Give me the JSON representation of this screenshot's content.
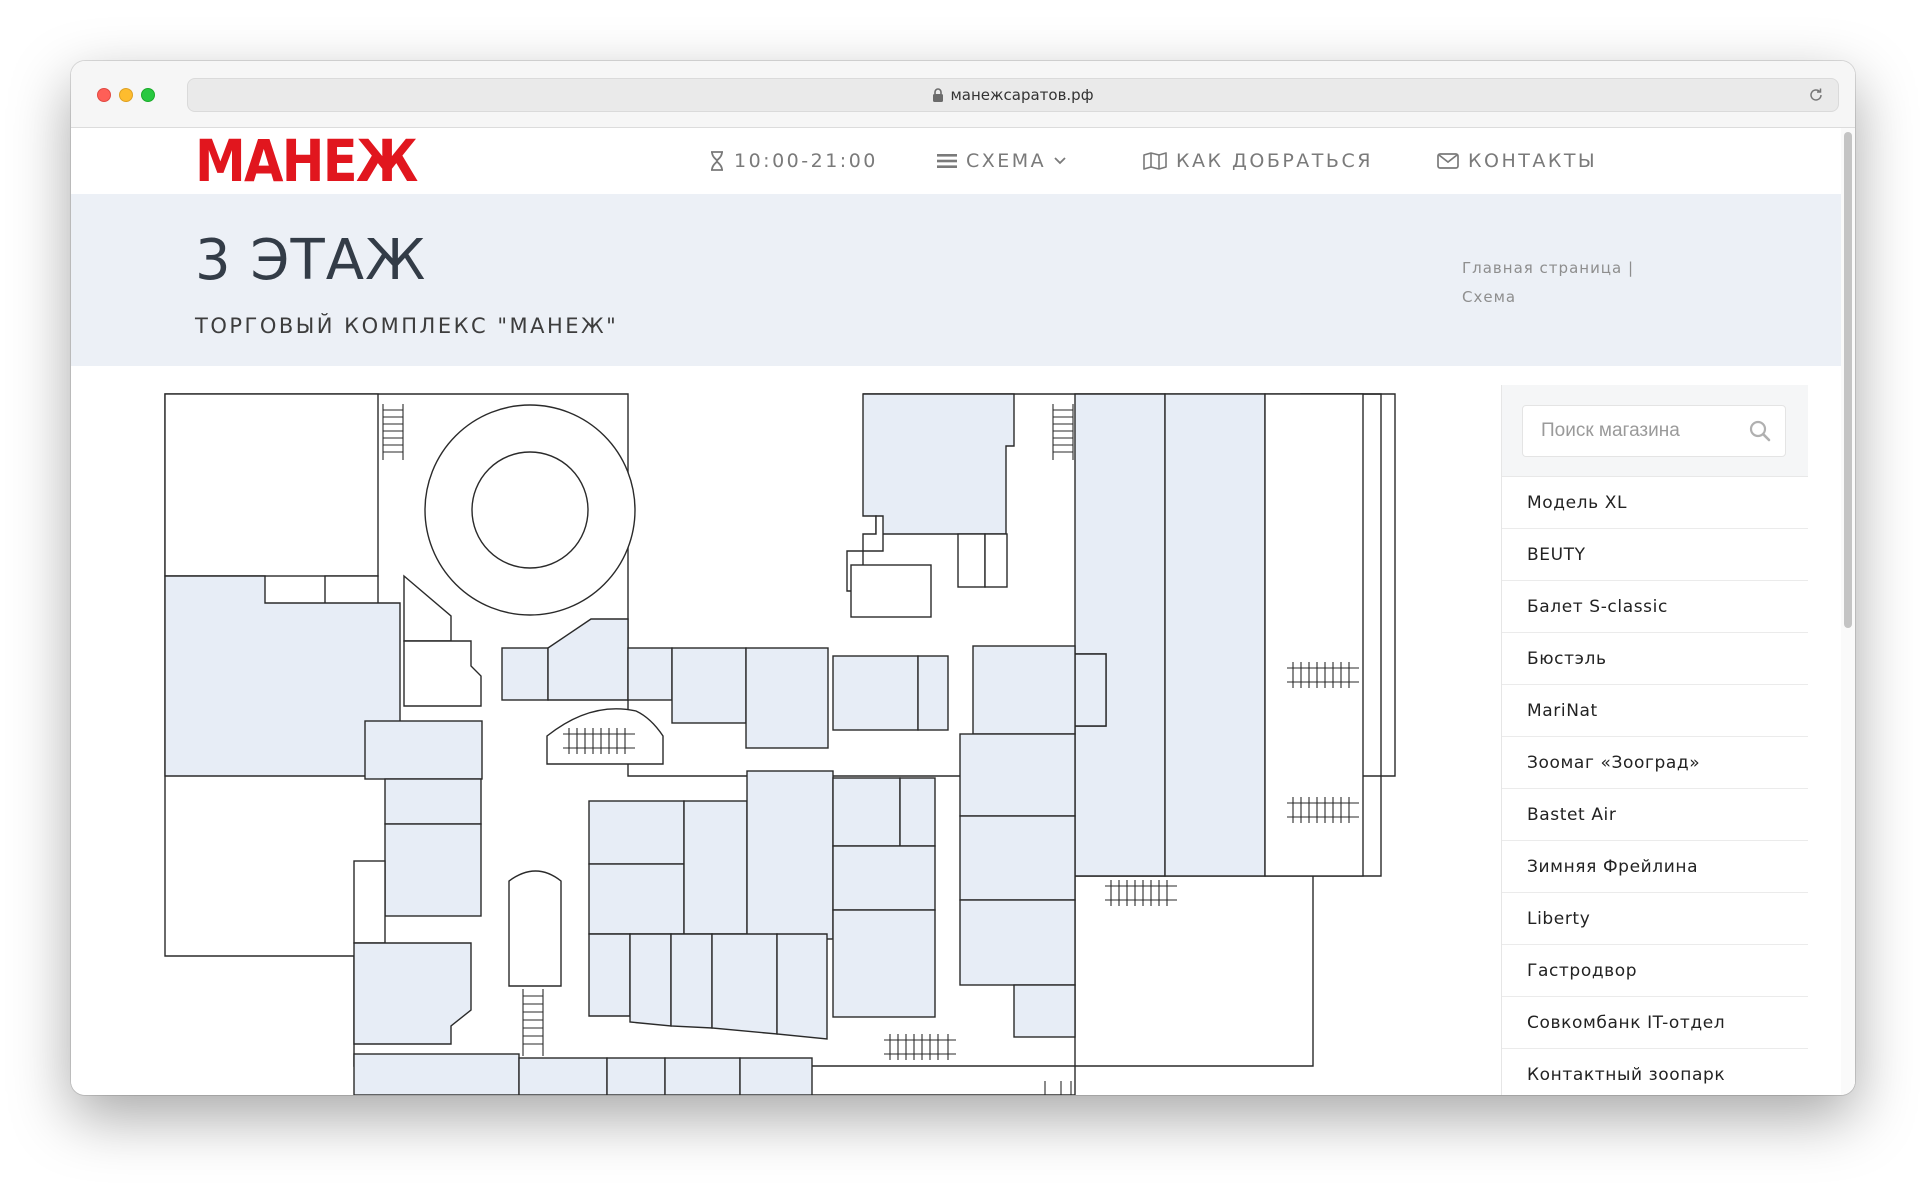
{
  "browser": {
    "url": "манежсаратов.рф"
  },
  "nav": {
    "logo": "МАНЕЖ",
    "hours": "10:00-21:00",
    "scheme": "СХЕМА",
    "route": "КАК ДОБРАТЬСЯ",
    "contacts": "КОНТАКТЫ"
  },
  "header": {
    "title": "3 ЭТАЖ",
    "subtitle": "ТОРГОВЫЙ КОМПЛЕКС \"МАНЕЖ\"",
    "breadcrumb": {
      "home": "Главная страница",
      "separator": "|",
      "current": "Схема"
    }
  },
  "sidebar": {
    "search_placeholder": "Поиск магазина",
    "stores": [
      "Модель XL",
      "BEUTY",
      "Балет S-classic",
      "Бюстэль",
      "MariNat",
      "Зоомаг «Зооград»",
      "Bastet Air",
      "Зимняя Фрейлина",
      "Liberty",
      "Гастродвор",
      "Совкомбанк IT-отдел",
      "Контактный зоопарк"
    ]
  },
  "colors": {
    "brand_red": "#e1161e",
    "unit_fill": "#e7edf6",
    "header_bg": "#ecf0f6",
    "nav_text": "#7a7a7a"
  },
  "icons": {
    "hours": "hourglass-icon",
    "scheme": "menu-icon",
    "route": "map-icon",
    "contacts": "envelope-icon",
    "search": "search-icon",
    "lock": "lock-icon",
    "reload": "reload-icon"
  }
}
